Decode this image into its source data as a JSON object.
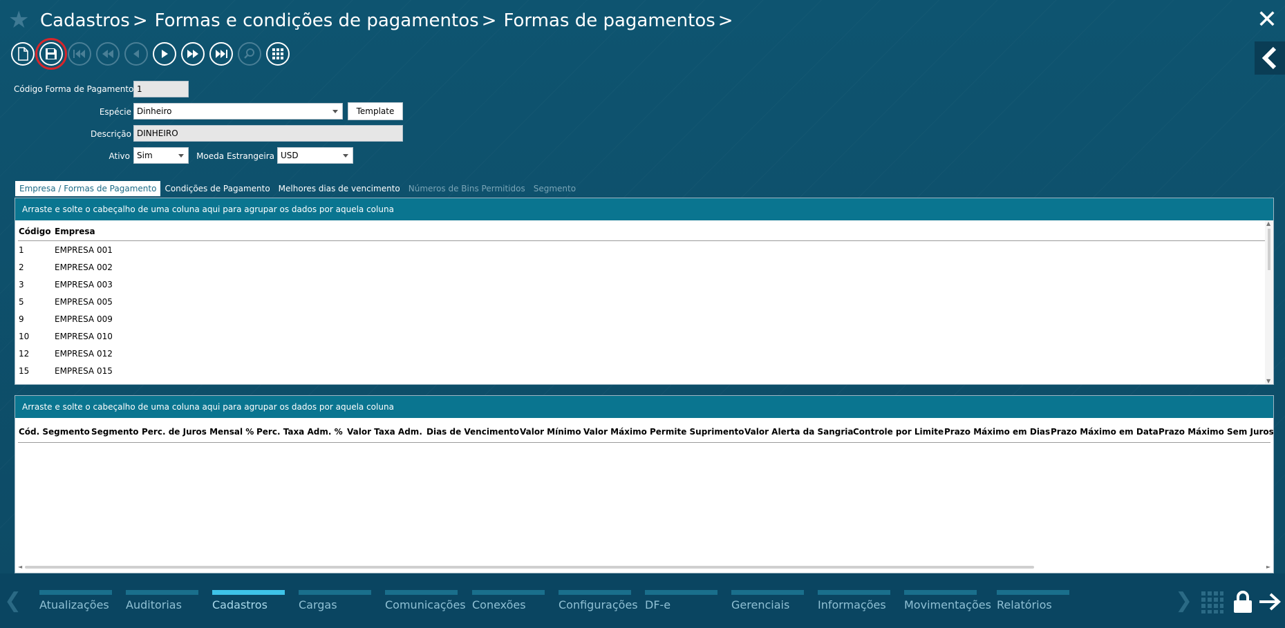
{
  "header": {
    "breadcrumb": [
      "Cadastros",
      "Formas e condições de pagamentos",
      "Formas de pagamentos"
    ],
    "separator": ">"
  },
  "icons": {
    "star": "star-icon",
    "close": "close-icon",
    "collapse": "chevron-left-icon"
  },
  "toolbar": [
    {
      "name": "new-button",
      "icon": "new-document-icon",
      "enabled": true
    },
    {
      "name": "save-button",
      "icon": "save-icon",
      "enabled": true,
      "selected": true
    },
    {
      "name": "first-button",
      "icon": "skip-first-icon",
      "enabled": false
    },
    {
      "name": "rewind-button",
      "icon": "rewind-icon",
      "enabled": false
    },
    {
      "name": "previous-button",
      "icon": "previous-icon",
      "enabled": false
    },
    {
      "name": "next-button",
      "icon": "next-icon",
      "enabled": true
    },
    {
      "name": "forward-button",
      "icon": "fast-forward-icon",
      "enabled": true
    },
    {
      "name": "last-button",
      "icon": "skip-last-icon",
      "enabled": true
    },
    {
      "name": "search-button",
      "icon": "search-icon",
      "enabled": false
    },
    {
      "name": "grid-button",
      "icon": "grid-icon",
      "enabled": true
    }
  ],
  "form": {
    "codigo_label": "Código Forma de Pagamento",
    "codigo_value": "1",
    "especie_label": "Espécie",
    "especie_value": "Dinheiro",
    "template_label": "Template",
    "descricao_label": "Descrição",
    "descricao_value": "DINHEIRO",
    "ativo_label": "Ativo",
    "ativo_value": "Sim",
    "moeda_label": "Moeda Estrangeira",
    "moeda_value": "USD"
  },
  "tabs": [
    {
      "label": "Empresa / Formas de Pagamento",
      "state": "active"
    },
    {
      "label": "Condições de Pagamento",
      "state": "normal"
    },
    {
      "label": "Melhores dias de vencimento",
      "state": "normal"
    },
    {
      "label": "Números de Bins Permitidos",
      "state": "disabled"
    },
    {
      "label": "Segmento",
      "state": "disabled"
    }
  ],
  "grid1": {
    "group_text": "Arraste e solte o cabeçalho de uma coluna aqui para agrupar os dados por aquela coluna",
    "columns": [
      "Código",
      "Empresa"
    ],
    "rows": [
      [
        "1",
        "EMPRESA 001"
      ],
      [
        "2",
        "EMPRESA 002"
      ],
      [
        "3",
        "EMPRESA 003"
      ],
      [
        "5",
        "EMPRESA 005"
      ],
      [
        "9",
        "EMPRESA 009"
      ],
      [
        "10",
        "EMPRESA 010"
      ],
      [
        "12",
        "EMPRESA 012"
      ],
      [
        "15",
        "EMPRESA 015"
      ]
    ]
  },
  "grid2": {
    "group_text": "Arraste e solte o cabeçalho de uma coluna aqui para agrupar os dados por aquela coluna",
    "columns": [
      "Cód. Segmento",
      "Segmento",
      "Perc. de Juros Mensal %",
      "Perc. Taxa Adm. %",
      "Valor Taxa Adm.",
      "Dias de Vencimento",
      "Valor Mínimo",
      "Valor Máximo",
      "Permite Suprimento",
      "Valor Alerta da Sangria",
      "Controle por Limite",
      "Prazo Máximo em Dias",
      "Prazo Máximo em Data",
      "Prazo Máximo Sem Juros e"
    ]
  },
  "bottom_nav": {
    "items": [
      {
        "label": "Atualizações",
        "active": false
      },
      {
        "label": "Auditorias",
        "active": false
      },
      {
        "label": "Cadastros",
        "active": true
      },
      {
        "label": "Cargas",
        "active": false
      },
      {
        "label": "Comunicações",
        "active": false
      },
      {
        "label": "Conexões",
        "active": false
      },
      {
        "label": "Configurações",
        "active": false
      },
      {
        "label": "DF-e",
        "active": false
      },
      {
        "label": "Gerenciais",
        "active": false
      },
      {
        "label": "Informações",
        "active": false
      },
      {
        "label": "Movimentações",
        "active": false
      },
      {
        "label": "Relatórios",
        "active": false
      }
    ],
    "icons": [
      "chevron-left-icon",
      "chevron-right-icon",
      "apps-grid-icon",
      "lock-icon",
      "logout-arrow-icon"
    ]
  }
}
